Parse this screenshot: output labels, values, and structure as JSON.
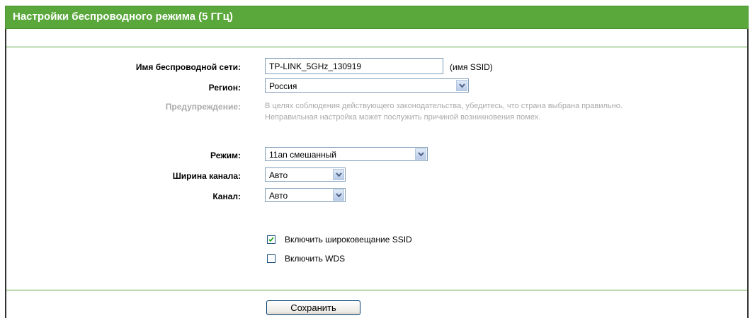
{
  "header": {
    "title": "Настройки беспроводного режима (5 ГГц)"
  },
  "form": {
    "ssid": {
      "label": "Имя беспроводной сети:",
      "value": "TP-LINK_5GHz_130919",
      "hint": "(имя SSID)"
    },
    "region": {
      "label": "Регион:",
      "value": "Россия"
    },
    "warning": {
      "label": "Предупреждение:",
      "line1": "В целях соблюдения действующего законодательства, убедитесь, что страна выбрана правильно.",
      "line2": "Неправильная настройка может послужить причиной возникновения помех."
    },
    "mode": {
      "label": "Режим:",
      "value": "11an смешанный"
    },
    "channel_width": {
      "label": "Ширина канала:",
      "value": "Авто"
    },
    "channel": {
      "label": "Канал:",
      "value": "Авто"
    },
    "ssid_broadcast": {
      "label": "Включить широковещание SSID",
      "checked": true
    },
    "wds": {
      "label": "Включить WDS",
      "checked": false
    }
  },
  "actions": {
    "save_label": "Сохранить"
  },
  "colors": {
    "header_bg": "#5aa83c",
    "separator": "#5aa83c",
    "warning_text": "#aaaaaa"
  },
  "icons": [
    "chevron-down-icon",
    "checkmark-icon"
  ]
}
